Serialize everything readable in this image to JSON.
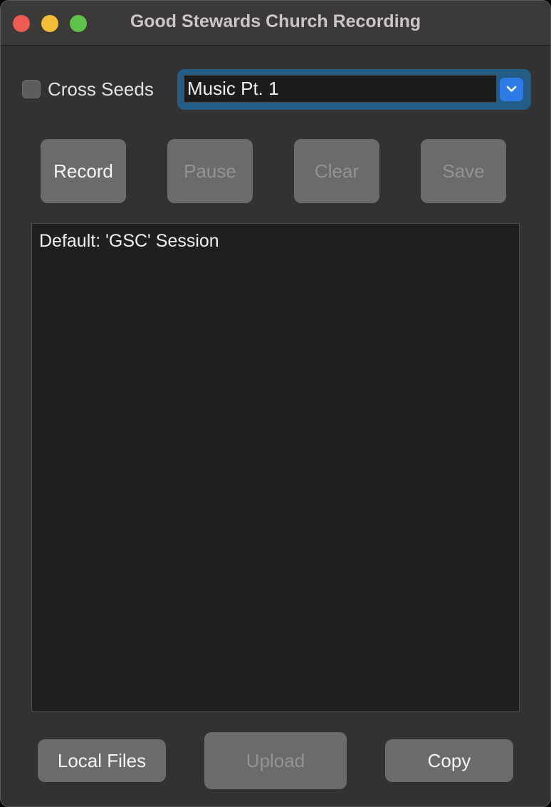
{
  "window": {
    "title": "Good Stewards Church Recording"
  },
  "options": {
    "cross_seeds_label": "Cross Seeds",
    "cross_seeds_checked": false,
    "session_select_value": "Music Pt. 1",
    "accent_color": "#2f7be6"
  },
  "controls": {
    "record_label": "Record",
    "pause_label": "Pause",
    "clear_label": "Clear",
    "save_label": "Save"
  },
  "log": {
    "lines": [
      "Default: 'GSC' Session"
    ]
  },
  "footer": {
    "local_files_label": "Local Files",
    "upload_label": "Upload",
    "copy_label": "Copy"
  },
  "icons": {
    "window_controls": [
      "close-icon",
      "minimize-icon",
      "maximize-icon"
    ],
    "select_arrow": "chevron-down-icon"
  }
}
